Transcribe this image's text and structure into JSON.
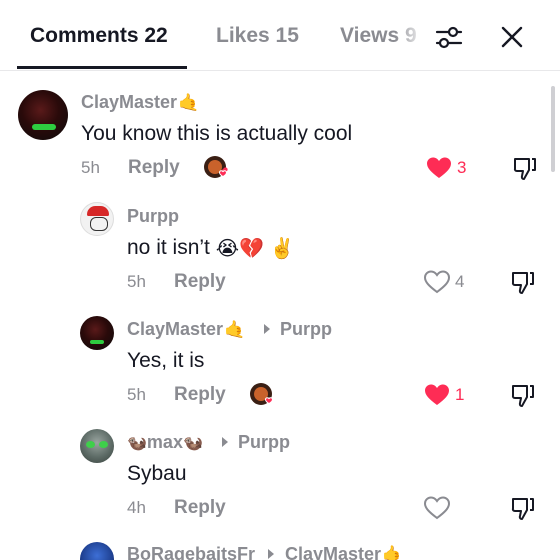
{
  "tabs": {
    "comments": "Comments 22",
    "likes": "Likes 15",
    "views": "Views 9"
  },
  "icons": {
    "filter": "sliders-icon",
    "close": "close-icon",
    "like_filled": "heart-filled-icon",
    "like_outline": "heart-outline-icon",
    "dislike": "thumbs-down-icon",
    "creator_liked": "creator-heart-avatar-icon"
  },
  "colors": {
    "like_red": "#fe2c55",
    "muted": "#8a8b91",
    "text": "#161823"
  },
  "comments": [
    {
      "username": "ClayMaster",
      "text": "You know this is actually cool",
      "time": "5h",
      "reply_label": "Reply",
      "likes": "3",
      "liked": true,
      "creator_liked": true
    },
    {
      "username": "Purpp",
      "text": "no it isn’t",
      "time": "5h",
      "reply_label": "Reply",
      "likes": "4",
      "liked": false
    },
    {
      "username": "ClayMaster",
      "reply_to": "Purpp",
      "text": "Yes, it is",
      "time": "5h",
      "reply_label": "Reply",
      "likes": "1",
      "liked": true,
      "creator_liked": true
    },
    {
      "username": "max",
      "reply_to": "Purpp",
      "text": "Sybau",
      "time": "4h",
      "reply_label": "Reply",
      "likes": "",
      "liked": false
    },
    {
      "username": "BoRagebaitsFr",
      "reply_to": "ClayMaster"
    }
  ]
}
